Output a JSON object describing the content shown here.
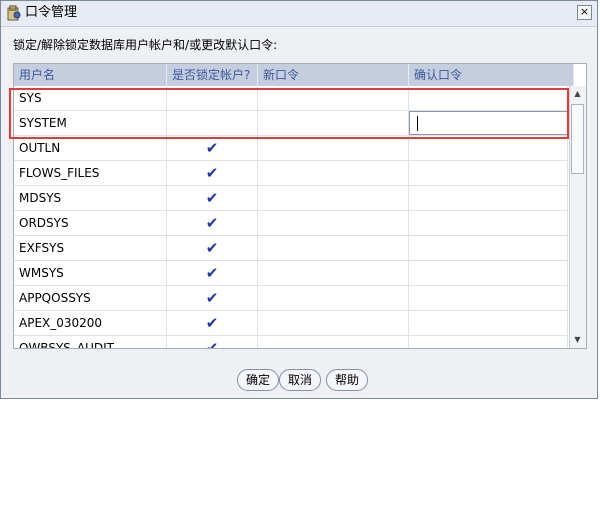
{
  "window": {
    "title": "口令管理",
    "close_glyph": "×"
  },
  "instruction": "锁定/解除锁定数据库用户帐户和/或更改默认口令:",
  "table": {
    "headers": [
      "用户名",
      "是否锁定帐户?",
      "新口令",
      "确认口令"
    ],
    "rows": [
      {
        "user": "SYS",
        "locked": false
      },
      {
        "user": "SYSTEM",
        "locked": false
      },
      {
        "user": "OUTLN",
        "locked": true
      },
      {
        "user": "FLOWS_FILES",
        "locked": true
      },
      {
        "user": "MDSYS",
        "locked": true
      },
      {
        "user": "ORDSYS",
        "locked": true
      },
      {
        "user": "EXFSYS",
        "locked": true
      },
      {
        "user": "WMSYS",
        "locked": true
      },
      {
        "user": "APPQOSSYS",
        "locked": true
      },
      {
        "user": "APEX_030200",
        "locked": true
      },
      {
        "user": "OWBSYS_AUDIT",
        "locked": true
      }
    ],
    "check_glyph": "✔"
  },
  "buttons": {
    "ok": "确定",
    "cancel": "取消",
    "help": "帮助"
  },
  "colors": {
    "header_bg": "#c4cede",
    "header_text": "#3a58a0",
    "highlight": "#e23b3b",
    "check": "#1f3aa0"
  },
  "icons": [
    "key-lock-icon",
    "close-icon",
    "scroll-up-icon",
    "scroll-down-icon",
    "checkmark-icon"
  ]
}
